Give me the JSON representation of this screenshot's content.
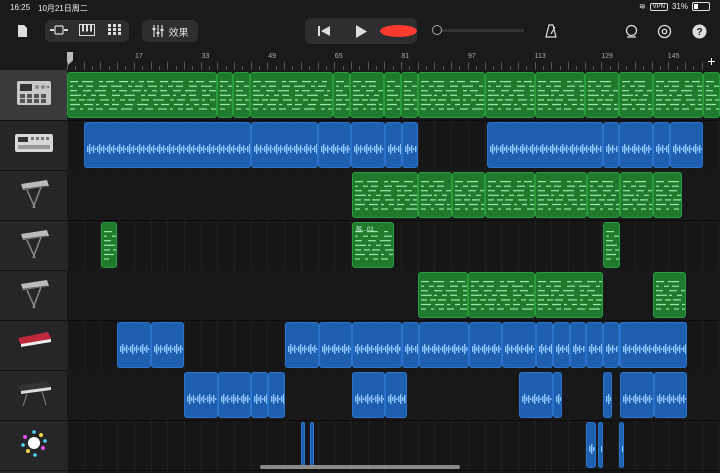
{
  "status": {
    "time": "16:25",
    "date": "10月21日周二",
    "vpn": "VPN",
    "battery": "31%"
  },
  "toolbar": {
    "effects_label": "效果"
  },
  "ruler": {
    "bars": [
      "17",
      "33",
      "49",
      "65",
      "81",
      "97",
      "113",
      "129",
      "145"
    ]
  },
  "tracks": [
    {
      "instrument": "drum-machine-icon",
      "regions": [
        {
          "type": "midi",
          "start": 0,
          "end": 150,
          "name": ""
        },
        {
          "type": "midi",
          "start": 150,
          "end": 166,
          "name": ""
        },
        {
          "type": "midi",
          "start": 166,
          "end": 183,
          "name": ""
        },
        {
          "type": "midi",
          "start": 183,
          "end": 266,
          "name": ""
        },
        {
          "type": "midi",
          "start": 266,
          "end": 283,
          "name": ""
        },
        {
          "type": "midi",
          "start": 283,
          "end": 317,
          "name": ""
        },
        {
          "type": "midi",
          "start": 317,
          "end": 334,
          "name": ""
        },
        {
          "type": "midi",
          "start": 334,
          "end": 351,
          "name": ""
        },
        {
          "type": "midi",
          "start": 351,
          "end": 418,
          "name": ""
        },
        {
          "type": "midi",
          "start": 418,
          "end": 468,
          "name": ""
        },
        {
          "type": "midi",
          "start": 468,
          "end": 518,
          "name": ""
        },
        {
          "type": "midi",
          "start": 518,
          "end": 552,
          "name": ""
        },
        {
          "type": "midi",
          "start": 552,
          "end": 586,
          "name": ""
        },
        {
          "type": "midi",
          "start": 586,
          "end": 636,
          "name": ""
        },
        {
          "type": "midi",
          "start": 636,
          "end": 653,
          "name": ""
        }
      ]
    },
    {
      "instrument": "sampler-icon",
      "regions": [
        {
          "type": "audio",
          "start": 17,
          "end": 184,
          "name": ""
        },
        {
          "type": "audio",
          "start": 184,
          "end": 251,
          "name": ""
        },
        {
          "type": "audio",
          "start": 251,
          "end": 284,
          "name": ""
        },
        {
          "type": "audio",
          "start": 284,
          "end": 318,
          "name": ""
        },
        {
          "type": "audio",
          "start": 318,
          "end": 335,
          "name": ""
        },
        {
          "type": "audio",
          "start": 335,
          "end": 351,
          "name": ""
        },
        {
          "type": "audio",
          "start": 420,
          "end": 536,
          "name": ""
        },
        {
          "type": "audio",
          "start": 536,
          "end": 552,
          "name": ""
        },
        {
          "type": "audio",
          "start": 552,
          "end": 586,
          "name": ""
        },
        {
          "type": "audio",
          "start": 586,
          "end": 603,
          "name": ""
        },
        {
          "type": "audio",
          "start": 603,
          "end": 636,
          "name": ""
        }
      ]
    },
    {
      "instrument": "keyboard-icon",
      "regions": [
        {
          "type": "midi",
          "start": 285,
          "end": 351,
          "name": ""
        },
        {
          "type": "midi",
          "start": 351,
          "end": 385,
          "name": ""
        },
        {
          "type": "midi",
          "start": 385,
          "end": 418,
          "name": ""
        },
        {
          "type": "midi",
          "start": 418,
          "end": 468,
          "name": ""
        },
        {
          "type": "midi",
          "start": 468,
          "end": 520,
          "name": ""
        },
        {
          "type": "midi",
          "start": 520,
          "end": 553,
          "name": ""
        },
        {
          "type": "midi",
          "start": 553,
          "end": 586,
          "name": ""
        },
        {
          "type": "midi",
          "start": 586,
          "end": 615,
          "name": ""
        }
      ]
    },
    {
      "instrument": "keyboard-icon",
      "regions": [
        {
          "type": "midi",
          "start": 34,
          "end": 50,
          "name": ""
        },
        {
          "type": "midi",
          "start": 285,
          "end": 327,
          "name": "层...01"
        },
        {
          "type": "midi",
          "start": 536,
          "end": 553,
          "name": ""
        }
      ]
    },
    {
      "instrument": "keyboard-icon",
      "regions": [
        {
          "type": "midi",
          "start": 351,
          "end": 401,
          "name": ""
        },
        {
          "type": "midi",
          "start": 401,
          "end": 468,
          "name": ""
        },
        {
          "type": "midi",
          "start": 468,
          "end": 536,
          "name": ""
        },
        {
          "type": "midi",
          "start": 586,
          "end": 619,
          "name": ""
        }
      ]
    },
    {
      "instrument": "red-synth-icon",
      "regions": [
        {
          "type": "audio",
          "start": 50,
          "end": 84,
          "name": ""
        },
        {
          "type": "audio",
          "start": 84,
          "end": 117,
          "name": ""
        },
        {
          "type": "audio",
          "start": 218,
          "end": 252,
          "name": ""
        },
        {
          "type": "audio",
          "start": 252,
          "end": 285,
          "name": ""
        },
        {
          "type": "audio",
          "start": 285,
          "end": 335,
          "name": ""
        },
        {
          "type": "audio",
          "start": 335,
          "end": 352,
          "name": ""
        },
        {
          "type": "audio",
          "start": 352,
          "end": 402,
          "name": ""
        },
        {
          "type": "audio",
          "start": 402,
          "end": 435,
          "name": ""
        },
        {
          "type": "audio",
          "start": 435,
          "end": 469,
          "name": ""
        },
        {
          "type": "audio",
          "start": 469,
          "end": 486,
          "name": ""
        },
        {
          "type": "audio",
          "start": 486,
          "end": 503,
          "name": ""
        },
        {
          "type": "audio",
          "start": 503,
          "end": 519,
          "name": ""
        },
        {
          "type": "audio",
          "start": 519,
          "end": 536,
          "name": ""
        },
        {
          "type": "audio",
          "start": 536,
          "end": 552,
          "name": ""
        },
        {
          "type": "audio",
          "start": 552,
          "end": 562,
          "name": ""
        },
        {
          "type": "audio",
          "start": 576,
          "end": 585,
          "name": ""
        },
        {
          "type": "audio",
          "start": 587,
          "end": 598,
          "name": ""
        },
        {
          "type": "audio",
          "start": 553,
          "end": 620,
          "name": ""
        }
      ]
    },
    {
      "instrument": "black-keyboard-icon",
      "regions": [
        {
          "type": "audio",
          "start": 117,
          "end": 151,
          "name": ""
        },
        {
          "type": "audio",
          "start": 151,
          "end": 184,
          "name": ""
        },
        {
          "type": "audio",
          "start": 184,
          "end": 201,
          "name": ""
        },
        {
          "type": "audio",
          "start": 201,
          "end": 218,
          "name": ""
        },
        {
          "type": "audio",
          "start": 285,
          "end": 318,
          "name": ""
        },
        {
          "type": "audio",
          "start": 318,
          "end": 340,
          "name": ""
        },
        {
          "type": "audio",
          "start": 452,
          "end": 486,
          "name": ""
        },
        {
          "type": "audio",
          "start": 486,
          "end": 495,
          "name": ""
        },
        {
          "type": "audio",
          "start": 536,
          "end": 545,
          "name": ""
        },
        {
          "type": "audio",
          "start": 553,
          "end": 587,
          "name": ""
        },
        {
          "type": "audio",
          "start": 587,
          "end": 620,
          "name": ""
        }
      ]
    },
    {
      "instrument": "sparkle-icon",
      "regions": [
        {
          "type": "audio",
          "start": 234,
          "end": 238,
          "name": ""
        },
        {
          "type": "audio",
          "start": 243,
          "end": 247,
          "name": ""
        },
        {
          "type": "audio",
          "start": 519,
          "end": 529,
          "name": ""
        },
        {
          "type": "audio",
          "start": 531,
          "end": 536,
          "name": ""
        },
        {
          "type": "audio",
          "start": 552,
          "end": 557,
          "name": ""
        }
      ]
    }
  ]
}
